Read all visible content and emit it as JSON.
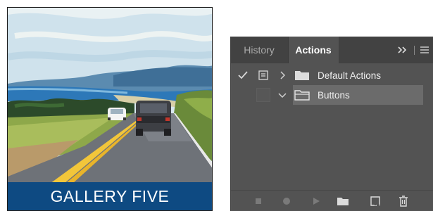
{
  "gallery": {
    "banner_text": "GALLERY FIVE",
    "banner_color": "#0e4a82"
  },
  "panel": {
    "tabs": [
      {
        "label": "History",
        "active": false
      },
      {
        "label": "Actions",
        "active": true
      }
    ],
    "collapse_icon": "double-chevron-right-icon",
    "menu_icon": "hamburger-menu-icon",
    "actions": [
      {
        "label": "Default Actions",
        "checked": true,
        "dialog_toggle": true,
        "expanded": false,
        "selected": false
      },
      {
        "label": "Buttons",
        "checked": false,
        "dialog_toggle": false,
        "expanded": true,
        "selected": true
      }
    ],
    "footer_buttons": [
      {
        "name": "stop-icon"
      },
      {
        "name": "record-icon"
      },
      {
        "name": "play-icon"
      },
      {
        "name": "new-set-folder-icon"
      },
      {
        "name": "new-action-icon"
      },
      {
        "name": "trash-icon"
      }
    ],
    "colors": {
      "panel_bg": "#535353",
      "tabbar_bg": "#424242",
      "selected_row": "#6b6b6b"
    }
  }
}
